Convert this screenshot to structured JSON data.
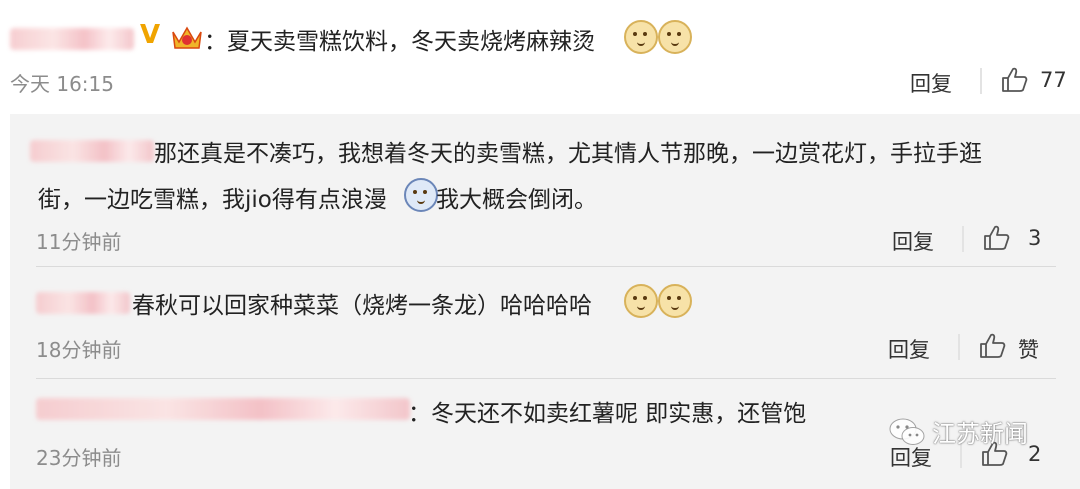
{
  "top_comment": {
    "text": "：夏天卖雪糕饮料，冬天卖烧烤麻辣烫",
    "time": "今天 16:15",
    "reply_label": "回复",
    "likes": "77",
    "badge_letter": "V"
  },
  "replies": [
    {
      "line1": "那还真是不凑巧，我想着冬天的卖雪糕，尤其情人节那晚，一边赏花灯，手拉手逛",
      "line2a": "街，一边吃雪糕，我jio得有点浪漫",
      "line2b": "我大概会倒闭。",
      "time": "11分钟前",
      "reply_label": "回复",
      "likes": "3"
    },
    {
      "text": "春秋可以回家种菜菜（烧烤一条龙）哈哈哈哈",
      "time": "18分钟前",
      "reply_label": "回复",
      "likes": "赞"
    },
    {
      "text": "：冬天还不如卖红薯呢 即实惠，还管饱",
      "time": "23分钟前",
      "reply_label": "回复",
      "likes": "2"
    }
  ],
  "watermark": {
    "text": "江苏新闻"
  },
  "icons": [
    "verified-icon",
    "vip-crown-icon",
    "doge-emoji-icon",
    "thumbs-up-icon",
    "shocked-emoji-icon",
    "wechat-icon"
  ]
}
